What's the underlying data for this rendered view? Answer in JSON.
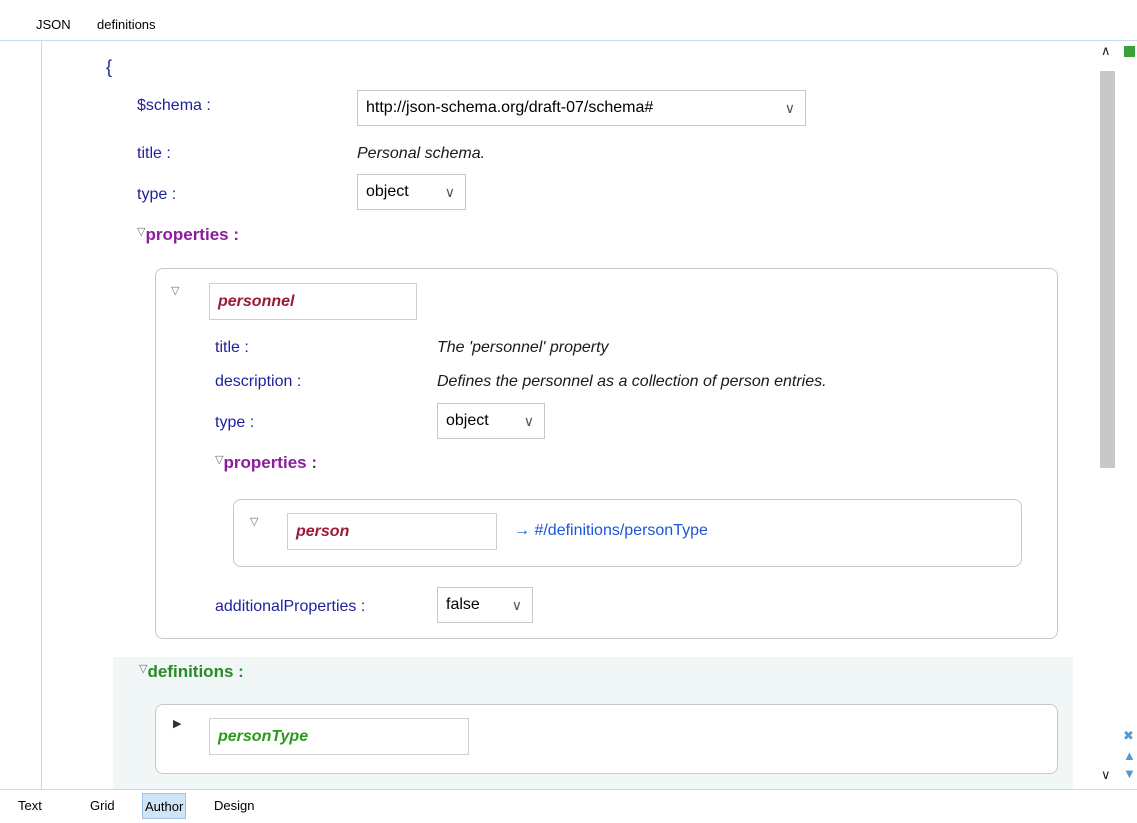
{
  "breadcrumb": {
    "items": [
      "JSON",
      "definitions"
    ]
  },
  "editor": {
    "open_brace": "{",
    "schema": {
      "key": "$schema :",
      "value": "http://json-schema.org/draft-07/schema#"
    },
    "title": {
      "key": "title :",
      "value": "Personal schema."
    },
    "type": {
      "key": "type :",
      "value": "object"
    },
    "properties_label": "properties :",
    "personnel": {
      "name": "personnel",
      "title": {
        "key": "title :",
        "value": "The 'personnel' property"
      },
      "description": {
        "key": "description :",
        "value": "Defines the personnel as a collection of person entries."
      },
      "type": {
        "key": "type :",
        "value": "object"
      },
      "properties_label": "properties :",
      "person": {
        "name": "person",
        "ref": "→ #/definitions/personType"
      },
      "additionalProperties": {
        "key": "additionalProperties :",
        "value": "false"
      }
    },
    "definitions_label": "definitions :",
    "personType": {
      "name": "personType"
    }
  },
  "tabs": [
    "Text",
    "Grid",
    "Author",
    "Design"
  ],
  "active_tab": "Author",
  "colors": {
    "key_blue": "#1f1f9e",
    "section_purple": "#8b1c9c",
    "section_green": "#2a8a2a",
    "name_red": "#9b1a3a",
    "name_green": "#2a9a1a",
    "ref_blue": "#1a56d8",
    "active_tab_bg": "#cfe4f6"
  },
  "icons": [
    "expanded-triangle-icon",
    "collapsed-triangle-icon",
    "chevron-down-icon",
    "scroll-up-icon",
    "scroll-down-icon",
    "close-icon",
    "nav-up-icon",
    "nav-down-icon"
  ]
}
